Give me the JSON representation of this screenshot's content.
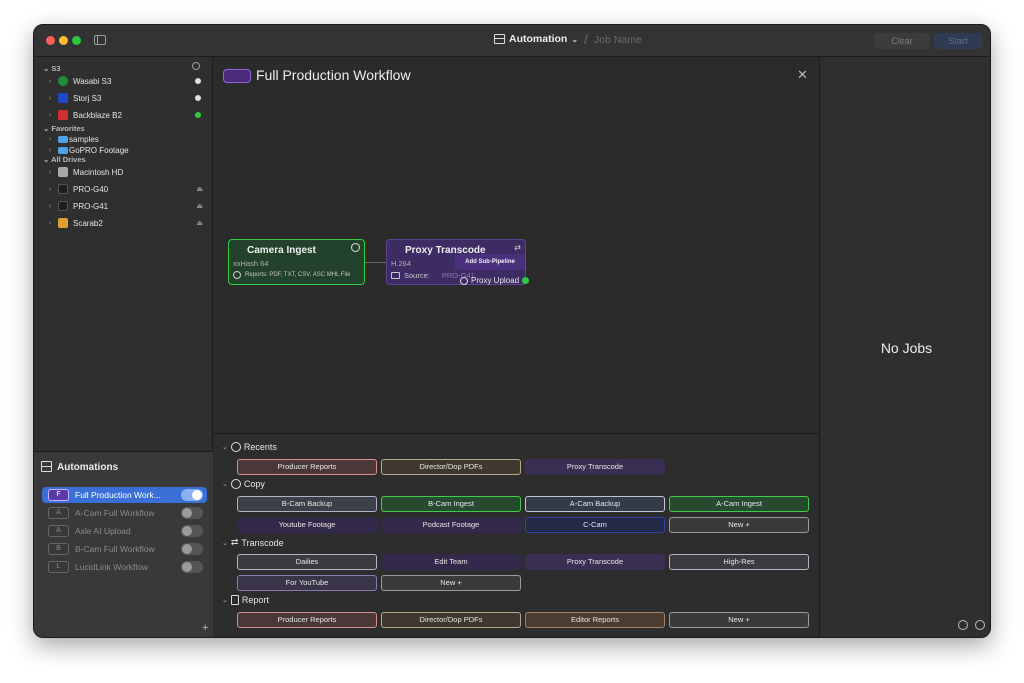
{
  "titlebar": {
    "mode": "Automation",
    "job_name_placeholder": "Job Name",
    "clear": "Clear",
    "start": "Start"
  },
  "sidebar": {
    "sections": {
      "s3": "S3",
      "favorites": "Favorites",
      "all_drives": "All Drives"
    },
    "s3_items": [
      "Wasabi S3",
      "Storj S3",
      "Backblaze B2"
    ],
    "favorites_items": [
      "samples",
      "GoPRO Footage"
    ],
    "drive_items": [
      "Macintosh HD",
      "PRO-G40",
      "PRO-G41",
      "Scarab2"
    ],
    "status_colors": {
      "wasabi": "#e0e0e0",
      "storj": "#e0e0e0",
      "b2": "#2ecc40"
    }
  },
  "automations": {
    "title": "Automations",
    "items": [
      {
        "badge": "F",
        "label": "Full Production Work...",
        "active": true
      },
      {
        "badge": "A",
        "label": "A-Cam Full Workflow",
        "active": false
      },
      {
        "badge": "A",
        "label": "Axle AI Upload",
        "active": false
      },
      {
        "badge": "B",
        "label": "B-Cam Full Workflow",
        "active": false
      },
      {
        "badge": "L",
        "label": "LucidLink Workflow",
        "active": false
      }
    ],
    "add_label": "+"
  },
  "editor": {
    "title": "Full Production Workflow",
    "nodes": {
      "ingest": {
        "title": "Camera Ingest",
        "hash": "xxHash 64",
        "reports": "Reports: PDF, TXT, CSV, ASC MHL File"
      },
      "proxy": {
        "title": "Proxy Transcode",
        "codec": "H.264",
        "source_label": "Source:",
        "source_value": "PRO-G41",
        "tooltip": "Add Sub-Pipeline",
        "next": "Proxy Upload"
      }
    }
  },
  "palette": {
    "recents": {
      "label": "Recents",
      "chips": [
        "Producer Reports",
        "Director/Dop PDFs",
        "Proxy Transcode"
      ]
    },
    "copy": {
      "label": "Copy",
      "chips": [
        "B-Cam Backup",
        "B-Cam Ingest",
        "A-Cam Backup",
        "A-Cam Ingest",
        "Youtube Footage",
        "Podcast Footage",
        "C-Cam",
        "New +"
      ]
    },
    "transcode": {
      "label": "Transcode",
      "chips": [
        "Dailies",
        "Edit Team",
        "Proxy Transcode",
        "High-Res",
        "For YouTube",
        "New +"
      ]
    },
    "report": {
      "label": "Report",
      "chips": [
        "Producer Reports",
        "Director/Dop PDFs",
        "Editor Reports",
        "New +"
      ]
    }
  },
  "jobs": {
    "empty_text": "No Jobs"
  }
}
